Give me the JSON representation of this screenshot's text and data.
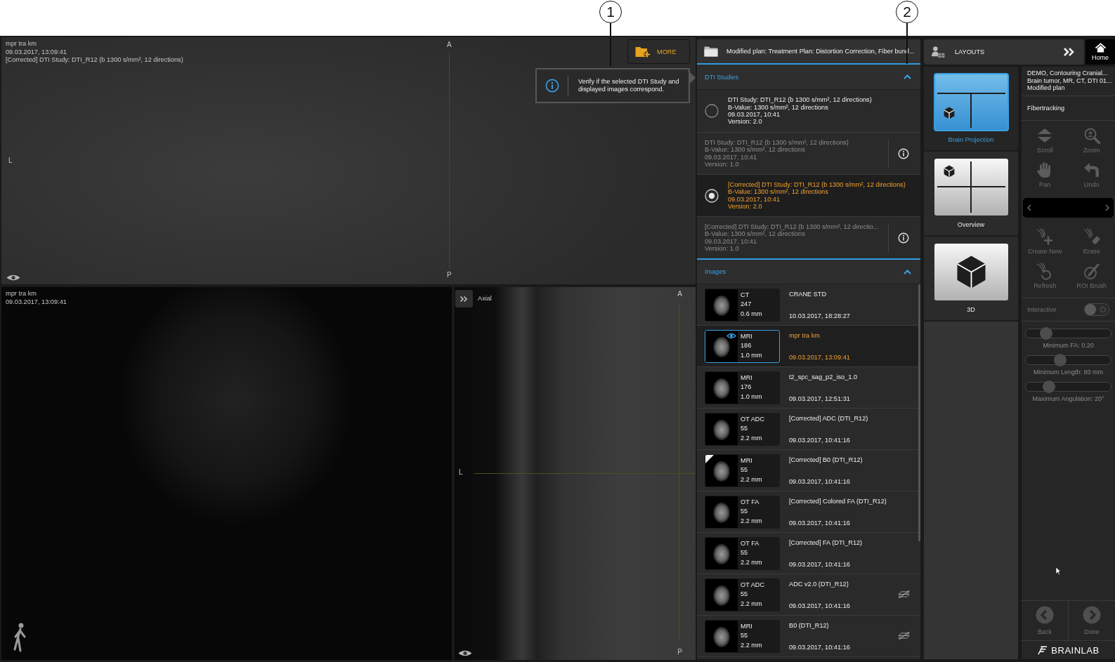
{
  "callouts": [
    {
      "number": "1"
    },
    {
      "number": "2"
    }
  ],
  "viewers": {
    "top": {
      "lines": [
        "mpr tra km",
        "09.03.2017, 13:09:41",
        "[Corrected] DTI Study: DTI_R12 (b 1300 s/mm², 12 directions)"
      ],
      "orientation": {
        "top": "A",
        "bottom": "P",
        "left": "L"
      }
    },
    "bottom_left": {
      "lines": [
        "mpr tra km",
        "09.03.2017, 13:09:41"
      ]
    },
    "bottom_right": {
      "view": "Axial",
      "orientation": {
        "top": "A",
        "bottom": "P",
        "left": "L"
      }
    }
  },
  "more_button": {
    "label": "MORE"
  },
  "tooltip": {
    "text": "Verify if the selected DTI Study and displayed images correspond."
  },
  "plan_panel": {
    "title": "Modified plan: Treatment Plan: Distortion Correction, Fiber bund...",
    "dti_studies": {
      "title": "DTI Studies",
      "expanded": true,
      "items": [
        {
          "kind": "radio",
          "selected": false,
          "disabled": false,
          "study": "DTI Study: DTI_R12 (b 1300 s/mm², 12 directions)",
          "b_value": "B-Value: 1300 s/mm², 12 directions",
          "date": "09.03.2017, 10:41",
          "version": "Version: 2.0"
        },
        {
          "kind": "info",
          "selected": false,
          "disabled": true,
          "study": "DTI Study: DTI_R12 (b 1300 s/mm², 12 directions)",
          "b_value": "B-Value: 1300 s/mm², 12 directions",
          "date": "09.03.2017, 10:41",
          "version": "Version: 1.0"
        },
        {
          "kind": "radio",
          "selected": true,
          "disabled": false,
          "study": "[Corrected] DTI Study: DTI_R12 (b 1300 s/mm², 12 directions)",
          "b_value": "B-Value: 1300 s/mm², 12 directions",
          "date": "09.03.2017, 10:41",
          "version": "Version: 2.0"
        },
        {
          "kind": "info",
          "selected": false,
          "disabled": true,
          "study": "[Corrected] DTI Study: DTI_R12 (b 1300 s/mm², 12 directio...",
          "b_value": "B-Value: 1300 s/mm², 12 directions",
          "date": "09.03.2017, 10:41",
          "version": "Version: 1.0"
        }
      ]
    },
    "images": {
      "title": "Images",
      "expanded": true,
      "items": [
        {
          "kind": "plain",
          "selected": false,
          "modality": "CT",
          "slices": "247",
          "thickness": "0.6 mm",
          "name": "CRANE STD",
          "date": "10.03.2017, 18:28:27"
        },
        {
          "kind": "plain",
          "selected": true,
          "modality": "MRI",
          "slices": "186",
          "thickness": "1.0 mm",
          "name": "mpr tra km",
          "date": "09.03.2017, 13:09:41"
        },
        {
          "kind": "plain",
          "selected": false,
          "modality": "MRI",
          "slices": "176",
          "thickness": "1.0 mm",
          "name": "t2_spc_sag_p2_iso_1.0",
          "date": "09.03.2017, 12:51:31"
        },
        {
          "kind": "plain",
          "selected": false,
          "modality": "OT ADC",
          "slices": "55",
          "thickness": "2.2 mm",
          "name": "[Corrected] ADC (DTI_R12)",
          "date": "09.03.2017, 10:41:16"
        },
        {
          "kind": "tagged",
          "selected": false,
          "modality": "MRI",
          "slices": "55",
          "thickness": "2.2 mm",
          "name": "[Corrected] B0 (DTI_R12)",
          "date": "09.03.2017, 10:41:16"
        },
        {
          "kind": "plain",
          "selected": false,
          "modality": "OT FA",
          "slices": "55",
          "thickness": "2.2 mm",
          "name": "[Corrected] Colored FA (DTI_R12)",
          "date": "09.03.2017, 10:41:16"
        },
        {
          "kind": "plain",
          "selected": false,
          "modality": "OT FA",
          "slices": "55",
          "thickness": "2.2 mm",
          "name": "[Corrected] FA (DTI_R12)",
          "date": "09.03.2017, 10:41:16"
        },
        {
          "kind": "planes",
          "selected": false,
          "modality": "OT ADC",
          "slices": "55",
          "thickness": "2.2 mm",
          "name": "ADC v2.0 (DTI_R12)",
          "date": "09.03.2017, 10:41:16"
        },
        {
          "kind": "planes",
          "selected": false,
          "modality": "MRI",
          "slices": "55",
          "thickness": "2.2 mm",
          "name": "B0 (DTI_R12)",
          "date": "09.03.2017, 10:41:16"
        }
      ]
    }
  },
  "layouts": {
    "title": "LAYOUTS",
    "items": [
      {
        "kind": "split",
        "label": "Brain Projection",
        "selected": true
      },
      {
        "kind": "quad",
        "label": "Overview",
        "selected": false
      },
      {
        "kind": "cube",
        "label": "3D",
        "selected": false
      }
    ]
  },
  "home_button": {
    "label": "Home"
  },
  "workflow": {
    "patient": [
      "DEMO, Contouring Cranial...",
      "Brain tumor, MR, CT, DTI 01...",
      "Modified plan"
    ],
    "step": "Fibertracking",
    "view_tools": [
      {
        "kind": "scroll",
        "label": "Scroll",
        "disabled": true
      },
      {
        "kind": "zoom",
        "label": "Zoom",
        "disabled": true
      },
      {
        "kind": "pan",
        "label": "Pan",
        "disabled": true
      },
      {
        "kind": "undo",
        "label": "Undo",
        "disabled": true
      }
    ],
    "fiber_tools": [
      {
        "kind": "create",
        "label": "Create New",
        "disabled": true
      },
      {
        "kind": "erase",
        "label": "Erase",
        "disabled": true
      },
      {
        "kind": "refresh",
        "label": "Refresh",
        "disabled": true
      },
      {
        "kind": "brush",
        "label": "ROI Brush",
        "disabled": true
      }
    ],
    "interactive": {
      "label": "Interactive",
      "on": false,
      "disabled": true
    },
    "sliders": [
      {
        "label": "Minimum FA: 0.20",
        "level": 0.19
      },
      {
        "label": "Minimum Length: 80 mm",
        "level": 0.39
      },
      {
        "label": "Maximum Angulation: 20°",
        "level": 0.23
      }
    ],
    "nav": [
      {
        "kind": "back",
        "label": "Back",
        "disabled": true
      },
      {
        "kind": "done",
        "label": "Done",
        "disabled": true
      }
    ],
    "logo": "BRAINLAB"
  }
}
